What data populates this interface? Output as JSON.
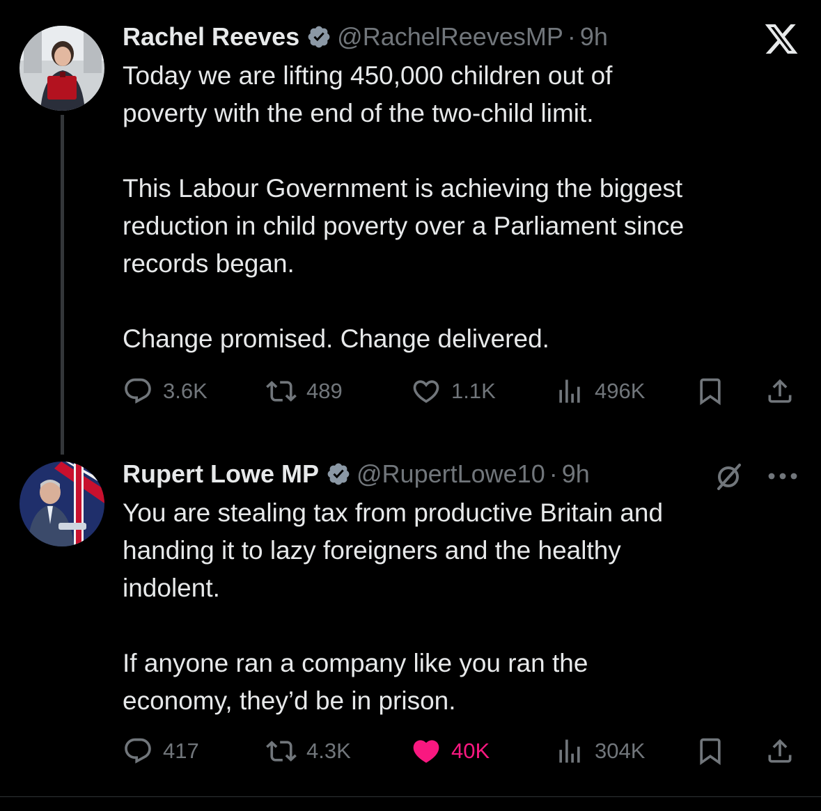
{
  "tweets": [
    {
      "name": "Rachel Reeves",
      "handle": "@RachelReevesMP",
      "time": "9h",
      "text": [
        "Today we are lifting 450,000 children out of",
        "poverty with the end of the two-child limit.",
        "",
        "This Labour Government is achieving the biggest",
        "reduction in child poverty over a Parliament since",
        "records began.",
        "",
        "Change promised. Change delivered."
      ],
      "replies": "3.6K",
      "reposts": "489",
      "likes": "1.1K",
      "views": "496K",
      "liked": false
    },
    {
      "name": "Rupert Lowe MP",
      "handle": "@RupertLowe10",
      "time": "9h",
      "text": [
        "You are stealing tax from productive Britain and",
        "handing it to lazy foreigners and the healthy",
        "indolent.",
        "",
        "If anyone ran a company like you ran the",
        "economy, they’d be in prison."
      ],
      "replies": "417",
      "reposts": "4.3K",
      "likes": "40K",
      "views": "304K",
      "liked": true
    }
  ],
  "icons": {
    "verified": "verified-badge-icon",
    "x_logo": "x-logo-icon",
    "grok": "grok-icon",
    "more": "more-icon",
    "reply": "reply-icon",
    "repost": "repost-icon",
    "like": "heart-icon",
    "views": "views-icon",
    "bookmark": "bookmark-icon",
    "share": "share-icon"
  },
  "colors": {
    "background": "#000000",
    "text": "#e7e9ea",
    "muted": "#71767b",
    "like_active": "#f91880",
    "verified_badge": "#8b98a5"
  }
}
